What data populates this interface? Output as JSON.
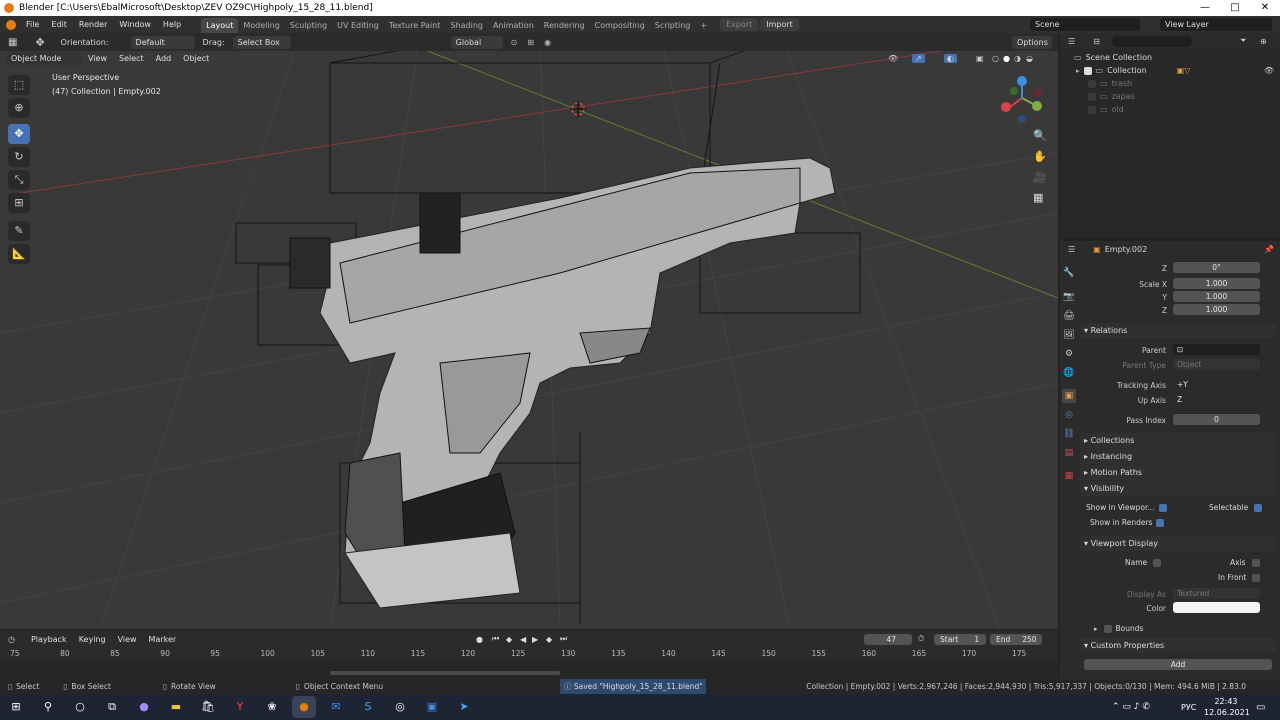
{
  "window": {
    "title": "Blender [C:\\Users\\EbalMicrosoft\\Desktop\\ZEV OZ9C\\Highpoly_15_28_11.blend]",
    "minimize": "—",
    "maximize": "□",
    "close": "✕"
  },
  "menu": [
    "File",
    "Edit",
    "Render",
    "Window",
    "Help"
  ],
  "workspaces": [
    "Layout",
    "Modeling",
    "Sculpting",
    "UV Editing",
    "Texture Paint",
    "Shading",
    "Animation",
    "Rendering",
    "Compositing",
    "Scripting"
  ],
  "workspace_add": "+",
  "export_btn": "Export",
  "import_btn": "Import",
  "scene": "Scene",
  "view_layer": "View Layer",
  "header": {
    "orientation_label": "Orientation:",
    "orientation_value": "Default",
    "drag_label": "Drag:",
    "drag_value": "Select Box",
    "transform_orientation": "Global",
    "options": "Options"
  },
  "viewport_menu": {
    "mode": "Object Mode",
    "items": [
      "View",
      "Select",
      "Add",
      "Object"
    ]
  },
  "viewport_info": {
    "perspective": "User Perspective",
    "collection": "(47) Collection | Empty.002"
  },
  "outliner": {
    "root": "Scene Collection",
    "items": [
      "Collection",
      "trash",
      "zapas",
      "old"
    ]
  },
  "properties": {
    "object_name": "Empty.002",
    "rotation_z_label": "Z",
    "rotation_z": "0°",
    "scale_x_label": "Scale X",
    "scale_y_label": "Y",
    "scale_z_label": "Z",
    "scale_x": "1.000",
    "scale_y": "1.000",
    "scale_z": "1.000",
    "relations": "Relations",
    "parent_label": "Parent",
    "parent_type_label": "Parent Type",
    "parent_type_value": "Object",
    "tracking_axis_label": "Tracking Axis",
    "tracking_axis_value": "+Y",
    "up_axis_label": "Up Axis",
    "up_axis_value": "Z",
    "pass_index_label": "Pass Index",
    "pass_index_value": "0",
    "collections": "Collections",
    "instancing": "Instancing",
    "motion_paths": "Motion Paths",
    "visibility": "Visibility",
    "show_in_viewports": "Show in Viewpor...",
    "selectable": "Selectable",
    "show_in_renders": "Show in Renders",
    "viewport_display": "Viewport Display",
    "name_label": "Name",
    "axis_label": "Axis",
    "in_front_label": "In Front",
    "display_as_label": "Display As",
    "display_as_value": "Textured",
    "color_label": "Color",
    "bounds_label": "Bounds",
    "custom_properties": "Custom Properties",
    "add_btn": "Add"
  },
  "timeline": {
    "menus": [
      "Playback",
      "Keying",
      "View",
      "Marker"
    ],
    "current_frame": "47",
    "start_label": "Start",
    "start_value": "1",
    "end_label": "End",
    "end_value": "250",
    "ticks": [
      "75",
      "80",
      "85",
      "90",
      "95",
      "100",
      "105",
      "110",
      "115",
      "120",
      "125",
      "130",
      "135",
      "140",
      "145",
      "150",
      "155",
      "160",
      "165",
      "170",
      "175"
    ]
  },
  "statusbar": {
    "select": "Select",
    "box_select": "Box Select",
    "rotate_view": "Rotate View",
    "context_menu": "Object Context Menu",
    "saved": "Saved \"Highpoly_15_28_11.blend\"",
    "stats": "Collection | Empty.002 | Verts:2,967,246 | Faces:2,944,930 | Tris:5,917,337 | Objects:0/130 | Mem: 494.6 MiB | 2.83.0"
  },
  "taskbar": {
    "lang": "РУС",
    "time": "22:43",
    "date": "12.06.2021"
  },
  "colors": {
    "accent": "#4772b3",
    "x_axis": "#d8424a",
    "y_axis": "#7fb03d",
    "z_axis": "#3f8ee0"
  }
}
